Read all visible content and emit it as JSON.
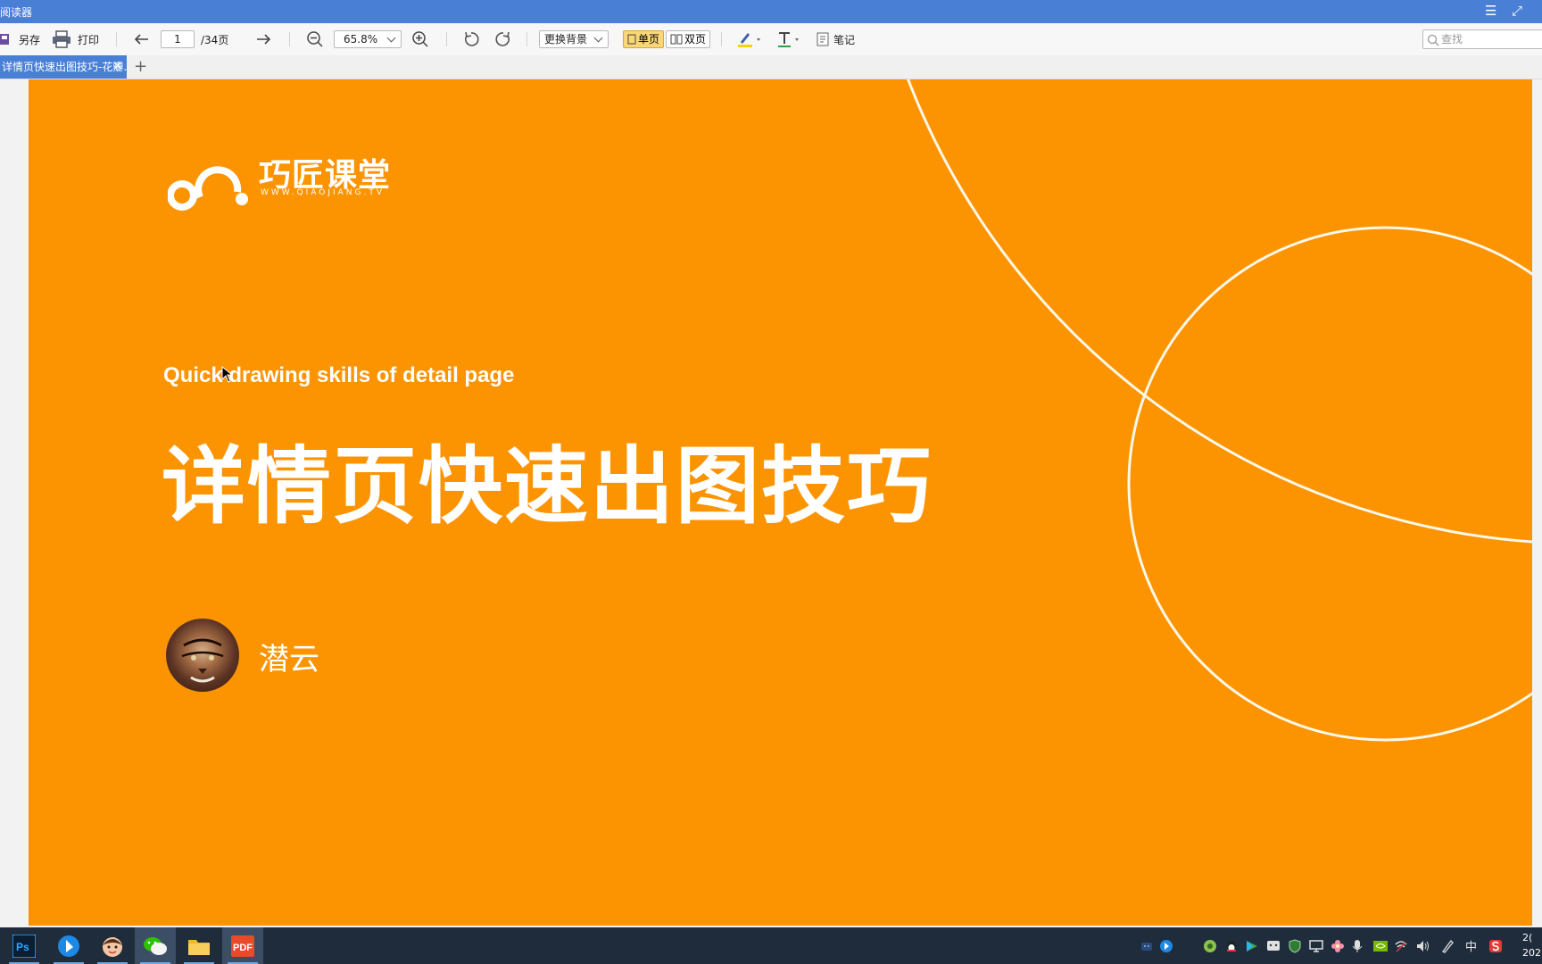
{
  "app": {
    "title": "阅读器"
  },
  "toolbar": {
    "save_as_label": "另存",
    "print_label": "打印",
    "current_page": "1",
    "total_pages": "/34页",
    "zoom": "65.8%",
    "background_select": "更换背景",
    "single_page_label": "单页",
    "double_page_label": "双页",
    "notes_label": "笔记",
    "search_placeholder": "查找"
  },
  "tabs": [
    {
      "label": "详情页快速出图技巧-花瓣..."
    }
  ],
  "slide": {
    "logo_name": "巧匠课堂",
    "logo_url": "WWW.QIAOJIANG.TV",
    "subtitle": "Quick drawing skills of detail page",
    "title": "详情页快速出图技巧",
    "author": "潜云",
    "background_color": "#fc9402"
  },
  "taskbar": {
    "apps": [
      "photoshop-icon",
      "media-player-icon",
      "browser-icon",
      "wechat-icon",
      "file-explorer-icon",
      "pdf-reader-icon"
    ],
    "ime_label": "中",
    "clock_time": "2(",
    "clock_date": "202"
  },
  "colors": {
    "titlebar": "#4a7fd6",
    "accent_orange": "#fc9402",
    "taskbar": "#1e2c3c"
  }
}
